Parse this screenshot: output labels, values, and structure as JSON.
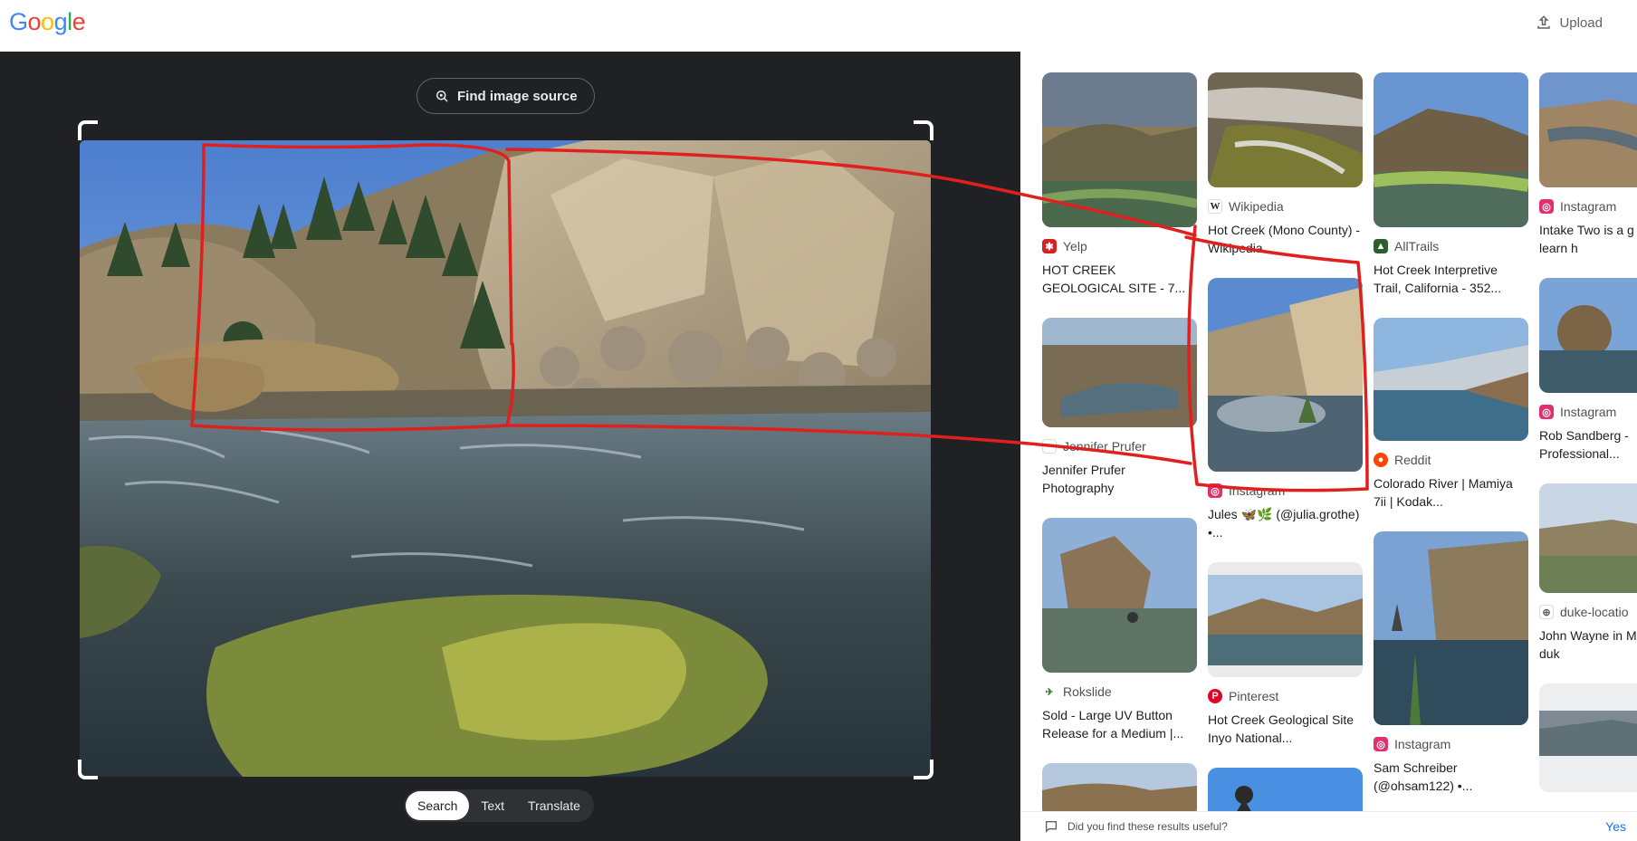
{
  "header": {
    "logo": "Google",
    "upload_label": "Upload"
  },
  "lens": {
    "find_source_label": "Find image source",
    "modes": [
      "Search",
      "Text",
      "Translate"
    ]
  },
  "results": {
    "columns": [
      [
        {
          "source": "Yelp",
          "title": "HOT CREEK GEOLOGICAL SITE - 7...",
          "favicon": "yelp-icon",
          "favcolor": "#d32323"
        },
        {
          "source": "Jennifer Prufer",
          "title": "Jennifer Prufer Photography",
          "favicon": "page-icon",
          "favcolor": "#dadce0"
        },
        {
          "source": "Rokslide",
          "title": "Sold - Large UV Button Release for a Medium |...",
          "favicon": "rokslide-icon",
          "favcolor": "#3c7a3c"
        },
        {
          "source": "",
          "title": "",
          "favicon": "",
          "favcolor": ""
        }
      ],
      [
        {
          "source": "Wikipedia",
          "title": "Hot Creek (Mono County) - Wikipedia",
          "favicon": "wikipedia-icon",
          "favcolor": "#ffffff"
        },
        {
          "source": "Instagram",
          "title": "Jules 🦋🌿 (@julia.grothe) •...",
          "favicon": "instagram-icon",
          "favcolor": "#e1306c"
        },
        {
          "source": "Pinterest",
          "title": "Hot Creek Geological Site Inyo National...",
          "favicon": "pinterest-icon",
          "favcolor": "#e60023"
        },
        {
          "source": "",
          "title": "",
          "favicon": "",
          "favcolor": ""
        }
      ],
      [
        {
          "source": "AllTrails",
          "title": "Hot Creek Interpretive Trail, California - 352...",
          "favicon": "alltrails-icon",
          "favcolor": "#2c5e2e"
        },
        {
          "source": "Reddit",
          "title": "Colorado River | Mamiya 7ii | Kodak...",
          "favicon": "reddit-icon",
          "favcolor": "#ff4500"
        },
        {
          "source": "Instagram",
          "title": "Sam Schreiber (@ohsam122) •...",
          "favicon": "instagram-icon",
          "favcolor": "#e1306c"
        }
      ],
      [
        {
          "source": "Instagram",
          "title": "Intake Two is a g place to learn h",
          "favicon": "instagram-icon",
          "favcolor": "#e1306c"
        },
        {
          "source": "Instagram",
          "title": "Rob Sandberg - Professional...",
          "favicon": "instagram-icon",
          "favcolor": "#e1306c"
        },
        {
          "source": "duke-locatio",
          "title": "John Wayne in Mammoth - duk",
          "favicon": "globe-icon",
          "favcolor": "#5f6368"
        },
        {
          "source": "",
          "title": "",
          "favicon": "",
          "favcolor": ""
        }
      ]
    ]
  },
  "feedback": {
    "question": "Did you find these results useful?",
    "yes": "Yes"
  }
}
